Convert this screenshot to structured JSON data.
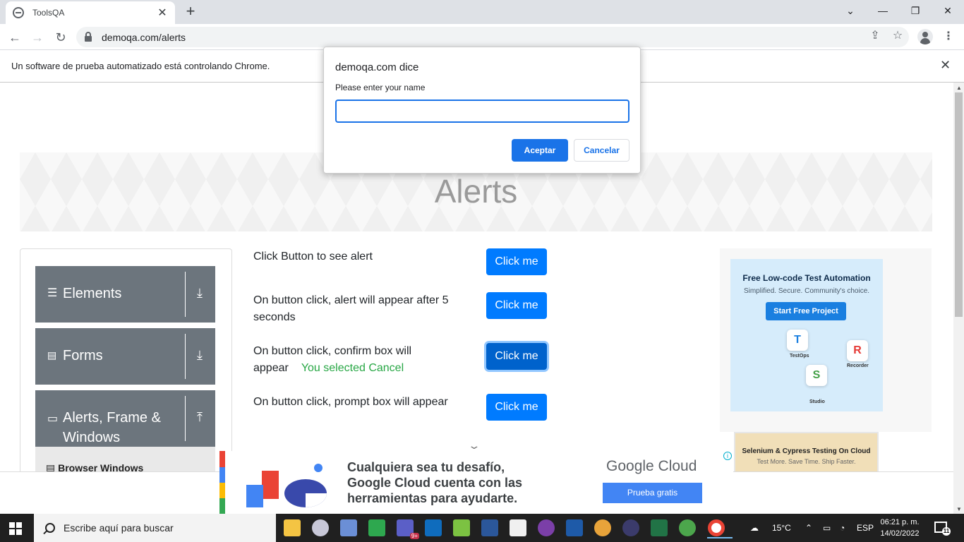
{
  "browser": {
    "tab_title": "ToolsQA",
    "tab_close": "✕",
    "new_tab": "+",
    "url": "demoqa.com/alerts",
    "infobar_message": "Un software de prueba automatizado está controlando Chrome.",
    "infobar_close": "✕"
  },
  "dialog": {
    "title": "demoqa.com dice",
    "message": "Please enter your name",
    "input_value": "",
    "ok_label": "Aceptar",
    "cancel_label": "Cancelar"
  },
  "page": {
    "heading": "Alerts",
    "sidebar": {
      "groups": [
        {
          "label": "Elements",
          "icon": "hamburger-icon",
          "arrow": "download-arrow-icon"
        },
        {
          "label": "Forms",
          "icon": "document-icon",
          "arrow": "download-arrow-icon"
        },
        {
          "label_line1": "Alerts, Frame &",
          "label_line2": "Windows",
          "icon": "window-icon",
          "arrow": "upload-arrow-icon"
        }
      ],
      "current_item": "Browser Windows"
    },
    "rows": [
      {
        "text": "Click Button to see alert",
        "button": "Click me"
      },
      {
        "text_line1": "On button click, alert will appear after 5",
        "text_line2": "seconds",
        "button": "Click me"
      },
      {
        "text_line1": "On button click, confirm box will",
        "text_line2": "appear",
        "result": "You selected Cancel",
        "button": "Click me"
      },
      {
        "text": "On button click, prompt box will appear",
        "button": "Click me"
      }
    ]
  },
  "ads": {
    "right_top": {
      "title": "Free Low-code Test Automation",
      "subtitle": "Simplified. Secure. Community's choice.",
      "cta": "Start Free Project",
      "labels": [
        "TestOps",
        "Recorder",
        "Studio"
      ]
    },
    "right_bottom": {
      "title": "Selenium & Cypress Testing On Cloud",
      "subtitle": "Test More. Save Time. Ship Faster."
    },
    "bottom": {
      "headline_line1": "Cualquiera sea tu desafío,",
      "headline_line2": "Google Cloud cuenta con las",
      "headline_line3": "herramientas para ayudarte.",
      "brand": "Google Cloud",
      "cta": "Prueba gratis"
    }
  },
  "taskbar": {
    "search_placeholder": "Escribe aquí para buscar",
    "teams_badge": "9+",
    "weather": "15°C",
    "language": "ESP",
    "time": "06:21 p. m.",
    "date": "14/02/2022",
    "notifications": "11"
  },
  "colors": {
    "primary_button": "#007bff",
    "sidebar_group": "#6c757d",
    "success_text": "#28a745",
    "chrome_blue": "#1a73e8"
  }
}
